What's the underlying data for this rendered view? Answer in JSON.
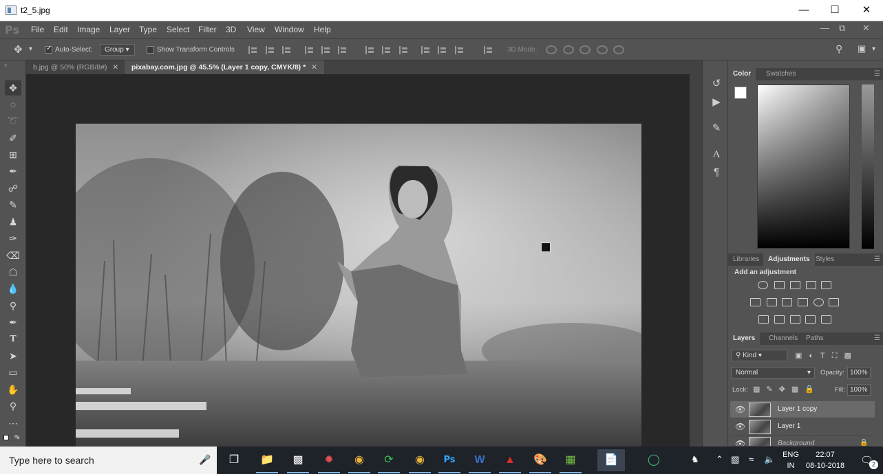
{
  "window": {
    "title": "t2_5.jpg",
    "minimize_icon": "minimize-icon",
    "maximize_icon": "maximize-icon",
    "close_icon": "close-icon"
  },
  "menubar": {
    "logo": "Ps",
    "items": [
      "File",
      "Edit",
      "Image",
      "Layer",
      "Type",
      "Select",
      "Filter",
      "3D",
      "View",
      "Window",
      "Help"
    ]
  },
  "options": {
    "auto_select_label": "Auto-Select:",
    "auto_select_checked": true,
    "auto_select_value": "Group",
    "show_transform_label": "Show Transform Controls",
    "show_transform_checked": false,
    "mode_3d_label": "3D Mode:"
  },
  "tabs": [
    {
      "label": "b.jpg @ 50% (RGB/8#)",
      "active": false
    },
    {
      "label": "pixabay.com.jpg @ 45.5% (Layer 1 copy, CMYK/8) *",
      "active": true
    }
  ],
  "tools": [
    "move-tool",
    "marquee-tool",
    "lasso-tool",
    "quick-select-tool",
    "crop-tool",
    "eyedropper-tool",
    "healing-brush-tool",
    "brush-tool",
    "clone-stamp-tool",
    "history-brush-tool",
    "eraser-tool",
    "paint-bucket-tool",
    "blur-tool",
    "dodge-tool",
    "pen-tool",
    "type-tool",
    "path-select-tool",
    "rectangle-tool",
    "hand-tool",
    "zoom-tool",
    "more-tools",
    "color-swatch"
  ],
  "color_panel": {
    "tabs": [
      "Color",
      "Swatches"
    ],
    "active_tab": "Color",
    "foreground": "#ffffff",
    "background": "#000000"
  },
  "adjust_panel": {
    "tabs": [
      "Libraries",
      "Adjustments",
      "Styles"
    ],
    "active_tab": "Adjustments",
    "heading": "Add an adjustment"
  },
  "layers_panel": {
    "tabs": [
      "Layers",
      "Channels",
      "Paths"
    ],
    "active_tab": "Layers",
    "filter_label": "Kind",
    "blend_mode": "Normal",
    "opacity_label": "Opacity:",
    "opacity_value": "100%",
    "lock_label": "Lock:",
    "fill_label": "Fill:",
    "fill_value": "100%",
    "layers": [
      {
        "name": "Layer 1 copy",
        "selected": true,
        "italic": false
      },
      {
        "name": "Layer 1",
        "selected": false,
        "italic": false
      },
      {
        "name": "Background",
        "selected": false,
        "italic": true
      }
    ]
  },
  "taskbar": {
    "search_placeholder": "Type here to search",
    "language": "ENG",
    "region": "IN",
    "time": "22:07",
    "date": "08-10-2018",
    "notification_count": "2"
  }
}
